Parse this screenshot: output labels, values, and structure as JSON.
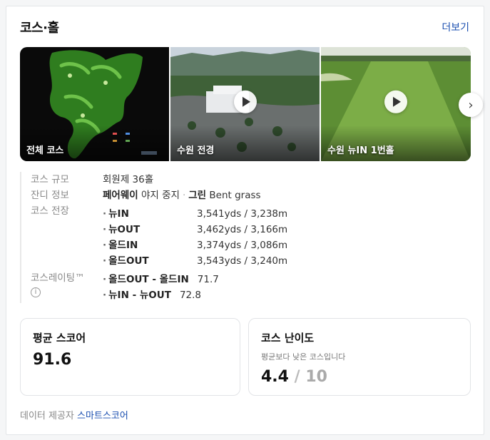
{
  "header": {
    "title": "코스·홀",
    "more_label": "더보기"
  },
  "media": [
    {
      "caption": "전체 코스",
      "type": "image"
    },
    {
      "caption": "수원 전경",
      "type": "video"
    },
    {
      "caption": "수원 뉴IN 1번홀",
      "type": "video"
    }
  ],
  "info": {
    "scale": {
      "label": "코스 규모",
      "value": "회원제 36홀"
    },
    "grass": {
      "label": "잔디 정보",
      "fairway": "페어웨이",
      "fairway_val": "야지 중지",
      "green": "그린",
      "green_val": "Bent grass"
    },
    "length": {
      "label": "코스 전장",
      "items": [
        {
          "name": "뉴IN",
          "value": "3,541yds / 3,238m"
        },
        {
          "name": "뉴OUT",
          "value": "3,462yds / 3,166m"
        },
        {
          "name": "올드IN",
          "value": "3,374yds / 3,086m"
        },
        {
          "name": "올드OUT",
          "value": "3,543yds / 3,240m"
        }
      ]
    },
    "rating": {
      "label": "코스레이팅™",
      "icon_text": "i",
      "items": [
        {
          "name": "올드OUT - 올드IN",
          "value": "71.7"
        },
        {
          "name": "뉴IN - 뉴OUT",
          "value": "72.8"
        }
      ]
    }
  },
  "avg_score": {
    "title": "평균 스코어",
    "value": "91.6"
  },
  "difficulty": {
    "title": "코스 난이도",
    "desc": "평균보다 낮은 코스입니다",
    "value": "4.4",
    "slash": "/",
    "max": "10"
  },
  "footer": {
    "label": "데이터 제공자",
    "provider": "스마트스코어"
  },
  "colors": {
    "accent": "#1b4fb0"
  },
  "icons": {
    "play": "play-icon",
    "next": "chevron-right-icon",
    "info": "info-icon"
  }
}
